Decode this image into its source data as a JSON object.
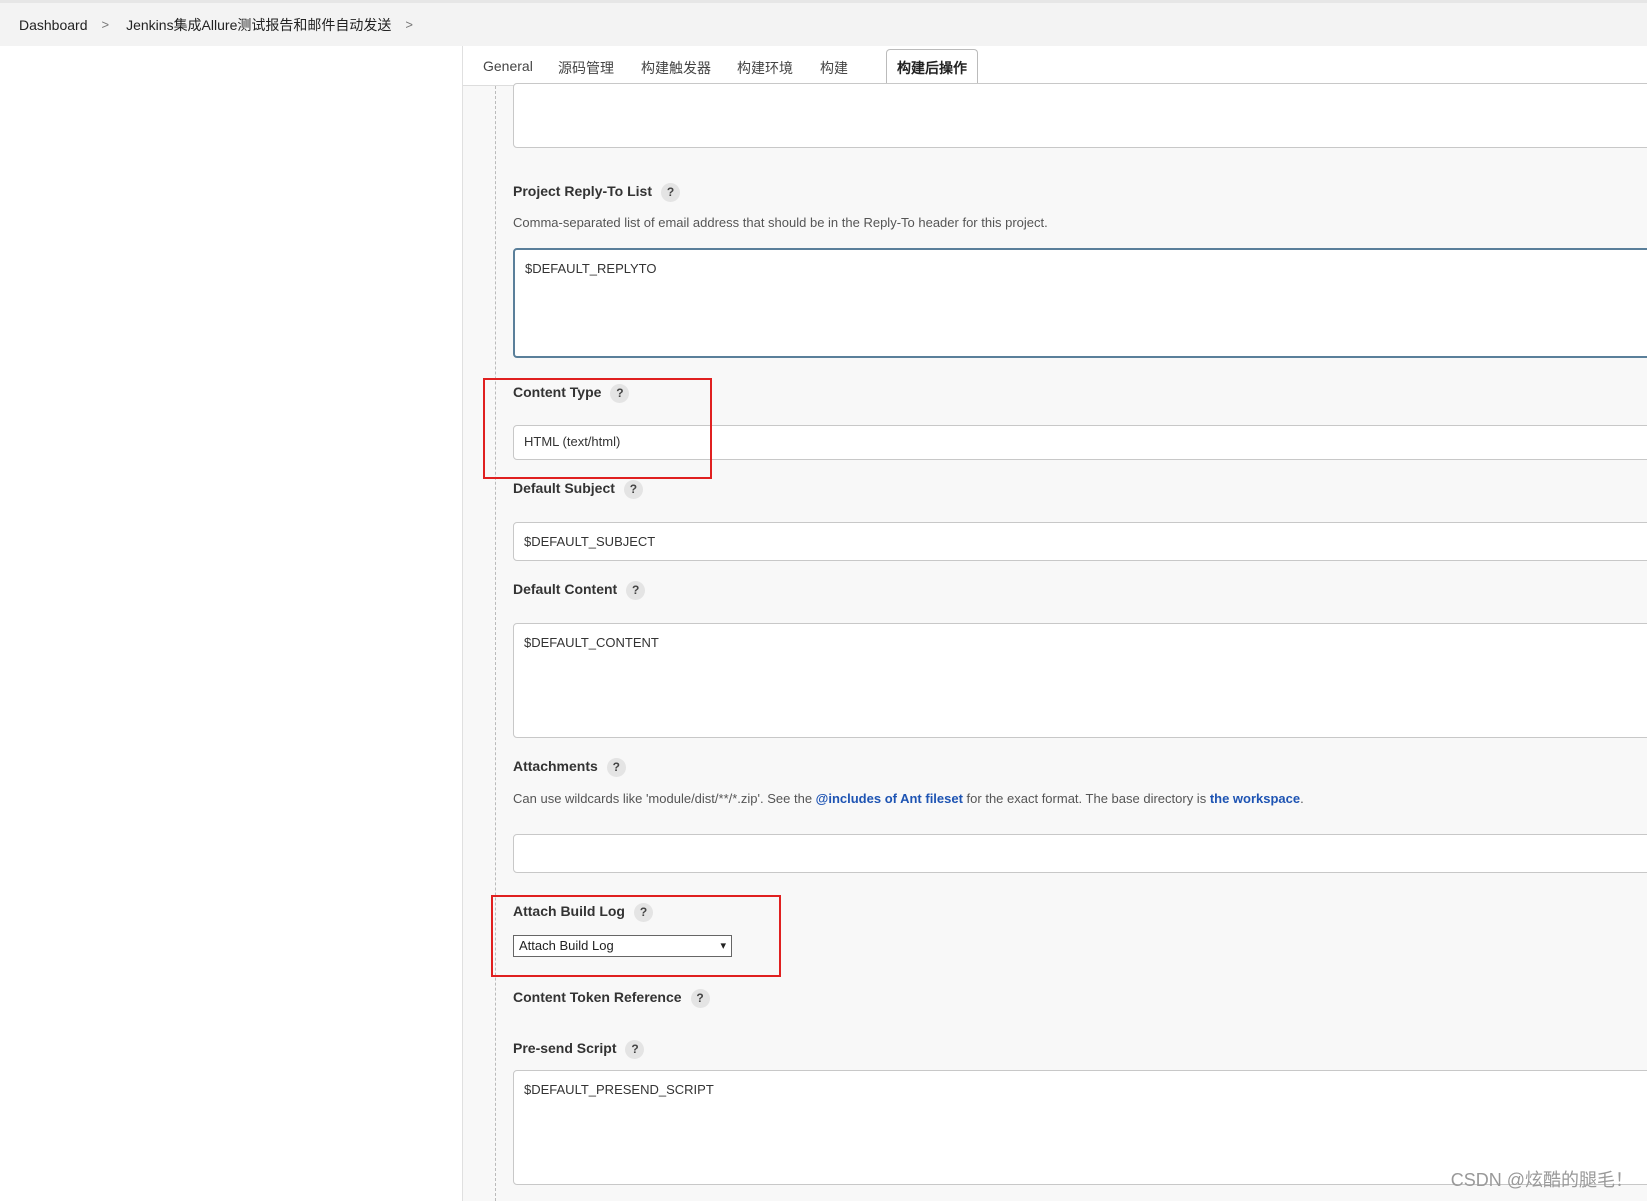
{
  "breadcrumb": {
    "items": [
      "Dashboard",
      "Jenkins集成Allure测试报告和邮件自动发送"
    ]
  },
  "tabs": [
    {
      "label": "General"
    },
    {
      "label": "源码管理"
    },
    {
      "label": "构建触发器"
    },
    {
      "label": "构建环境"
    },
    {
      "label": "构建"
    },
    {
      "label": "构建后操作",
      "active": true
    }
  ],
  "fields": {
    "reply_to": {
      "label": "Project Reply-To List",
      "description": "Comma-separated list of email address that should be in the Reply-To header for this project.",
      "value": "$DEFAULT_REPLYTO"
    },
    "content_type": {
      "label": "Content Type",
      "value": "HTML (text/html)"
    },
    "default_subject": {
      "label": "Default Subject",
      "value": "$DEFAULT_SUBJECT"
    },
    "default_content": {
      "label": "Default Content",
      "value": "$DEFAULT_CONTENT"
    },
    "attachments": {
      "label": "Attachments",
      "desc_prefix": "Can use wildcards like 'module/dist/**/*.zip'. See the ",
      "desc_link1": "@includes of Ant fileset",
      "desc_middle": " for the exact format. The base directory is ",
      "desc_link2": "the workspace",
      "desc_suffix": ".",
      "value": ""
    },
    "attach_build_log": {
      "label": "Attach Build Log",
      "selected": "Attach Build Log"
    },
    "content_token_reference": {
      "label": "Content Token Reference"
    },
    "pre_send_script": {
      "label": "Pre-send Script",
      "value": "$DEFAULT_PRESEND_SCRIPT"
    }
  },
  "help_glyph": "?",
  "chevron_glyph": ">",
  "select_caret_glyph": "▾",
  "watermark": "CSDN @炫酷的腿毛！",
  "colors": {
    "highlight_box": "#e02020",
    "link": "#1e54b3"
  }
}
